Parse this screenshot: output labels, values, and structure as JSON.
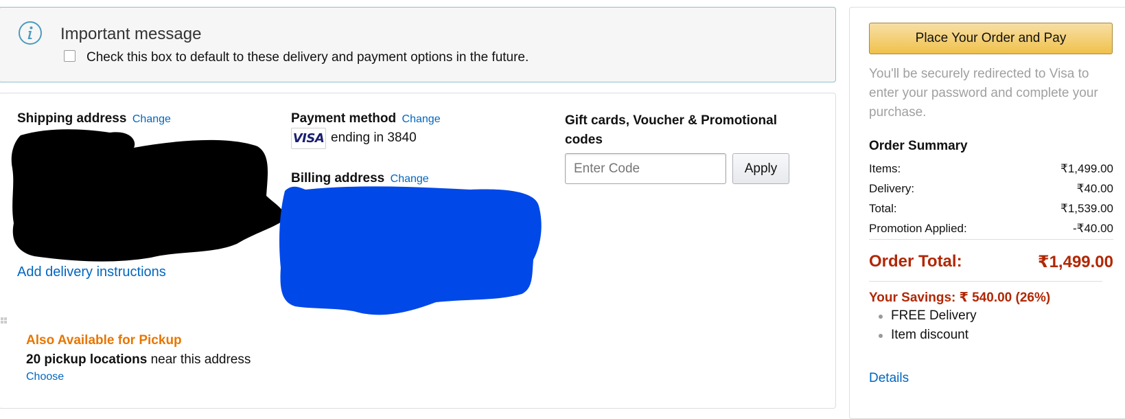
{
  "message": {
    "title": "Important message",
    "checkbox_label": "Check this box to default to these delivery and payment options in the future."
  },
  "shipping": {
    "heading": "Shipping address",
    "change_label": "Change",
    "delivery_instructions_label": "Add delivery instructions"
  },
  "pickup": {
    "title": "Also Available for Pickup",
    "count_text": "20 pickup locations",
    "near_text": " near this address",
    "choose_label": "Choose"
  },
  "payment": {
    "heading": "Payment method",
    "change_label": "Change",
    "card_brand": "VISA",
    "ending_text": "ending in 3840"
  },
  "billing": {
    "heading": "Billing address",
    "change_label": "Change"
  },
  "gift": {
    "heading": "Gift cards, Voucher & Promotional codes",
    "input_placeholder": "Enter Code",
    "apply_label": "Apply"
  },
  "order": {
    "place_order_label": "Place Your Order and Pay",
    "redirect_note": "You'll be securely redirected to Visa to enter your password and complete your purchase.",
    "summary_heading": "Order Summary",
    "rows": [
      {
        "label": "Items:",
        "amount": "₹1,499.00"
      },
      {
        "label": "Delivery:",
        "amount": "₹40.00"
      },
      {
        "label": "Total:",
        "amount": "₹1,539.00"
      },
      {
        "label": "Promotion Applied:",
        "amount": "-₹40.00"
      }
    ],
    "total_label": "Order Total:",
    "total_amount": "₹1,499.00",
    "savings_text": "Your Savings: ₹ 540.00 (26%)",
    "savings_items": [
      "FREE Delivery",
      "Item discount"
    ],
    "details_label": "Details"
  },
  "colors": {
    "link": "#0066c0",
    "pickup_orange": "#e77600",
    "price_red": "#b12704",
    "redaction_black": "#000000",
    "redaction_blue": "#0048e8"
  }
}
